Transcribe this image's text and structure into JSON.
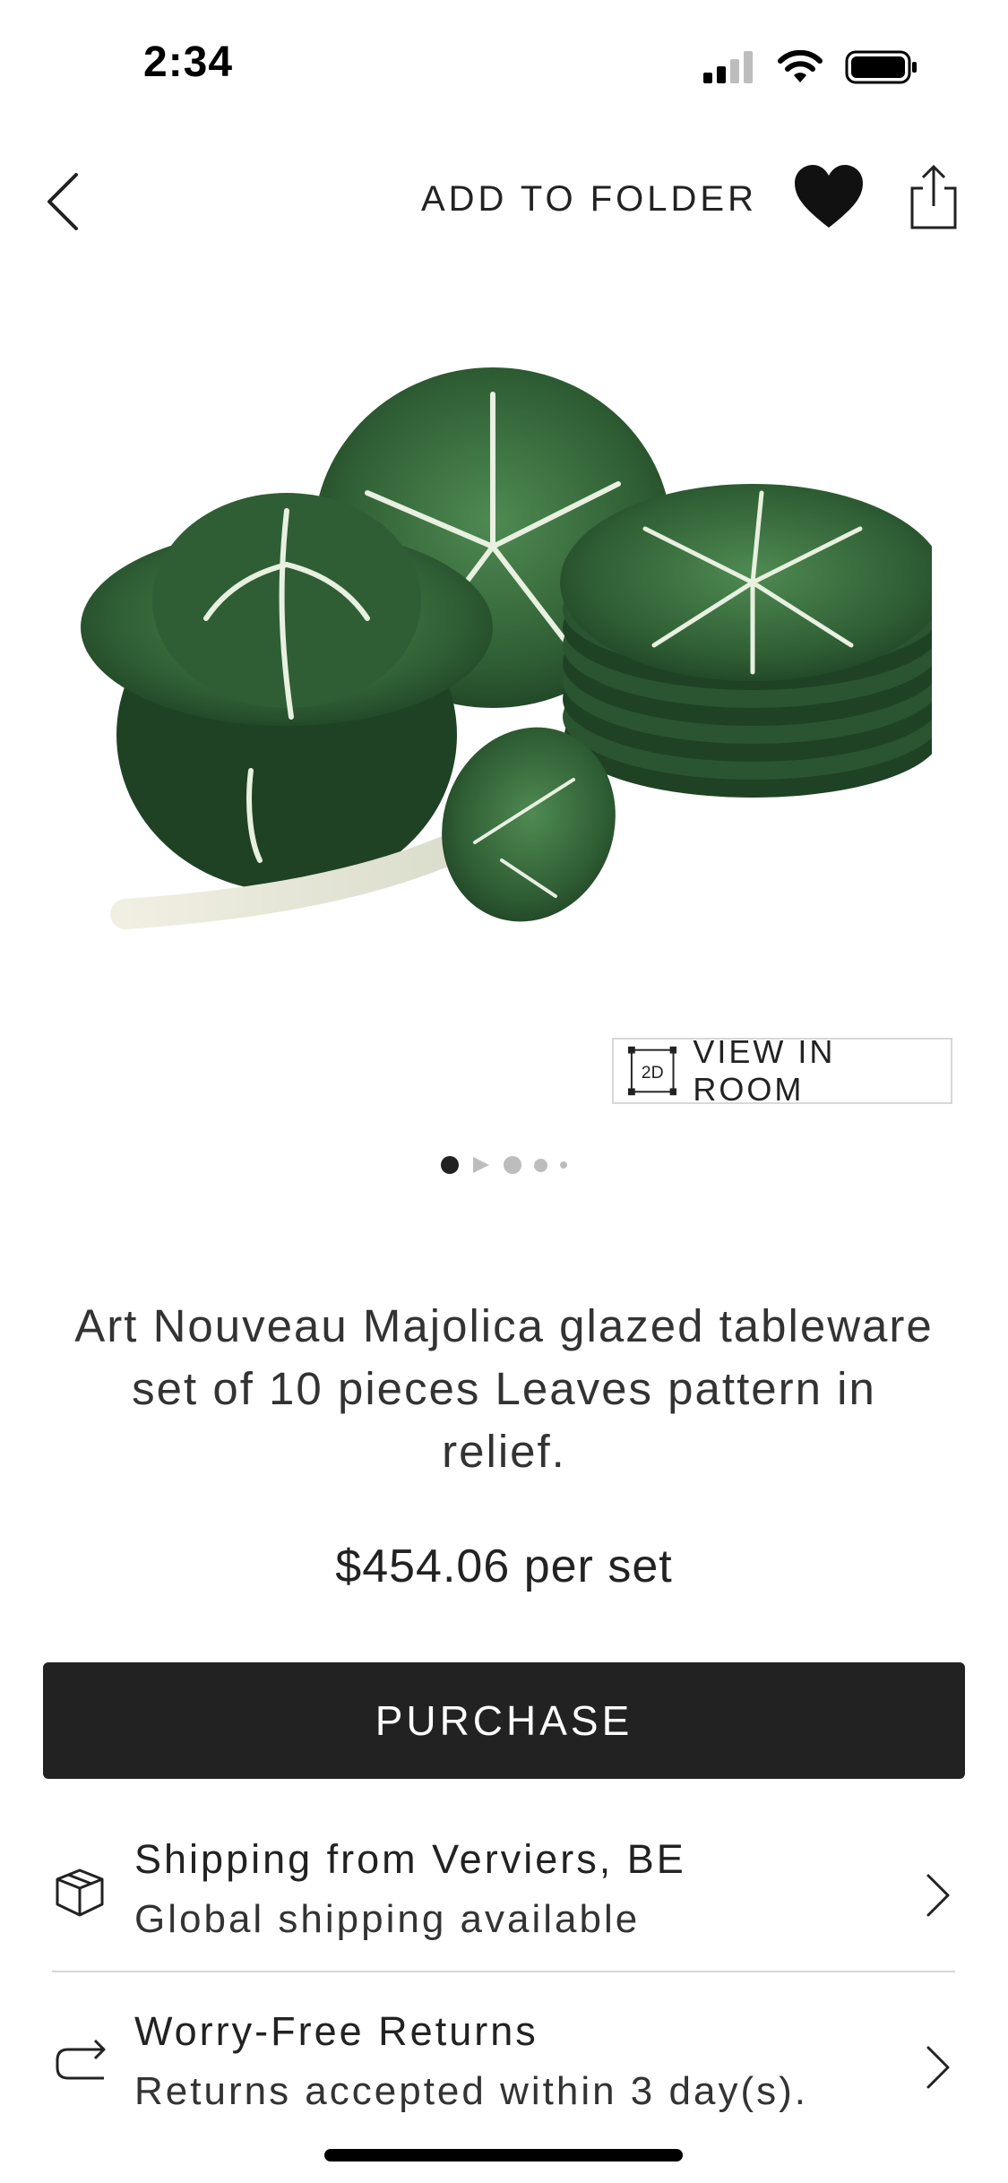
{
  "status_bar": {
    "time": "2:34",
    "icons": [
      "cellular-signal-icon",
      "wifi-icon",
      "battery-icon"
    ]
  },
  "nav": {
    "back_icon": "chevron-left-icon",
    "add_to_folder_label": "ADD TO FOLDER",
    "favorite_icon": "heart-icon",
    "share_icon": "share-icon"
  },
  "product": {
    "image_description_icon": "product-photo",
    "view_in_room": {
      "icon_label": "2D",
      "label": "VIEW IN ROOM"
    },
    "carousel": {
      "total_items": 5,
      "active_index": 0
    },
    "title": "Art Nouveau Majolica glazed tableware set of 10 pieces Leaves pattern in relief.",
    "price": "$454.06 per set",
    "purchase_label": "PURCHASE"
  },
  "info_rows": [
    {
      "icon": "package-box-icon",
      "title": "Shipping from Verviers, BE",
      "subtitle": "Global shipping available"
    },
    {
      "icon": "return-arrow-icon",
      "title": "Worry-Free Returns",
      "subtitle": "Returns accepted within 3 day(s)."
    }
  ],
  "colors": {
    "primary_button": "#222222",
    "text": "#222222",
    "divider": "#d6d6d6",
    "inactive_dot": "#bdbdbd",
    "leaf_green": "#2f5e34"
  }
}
